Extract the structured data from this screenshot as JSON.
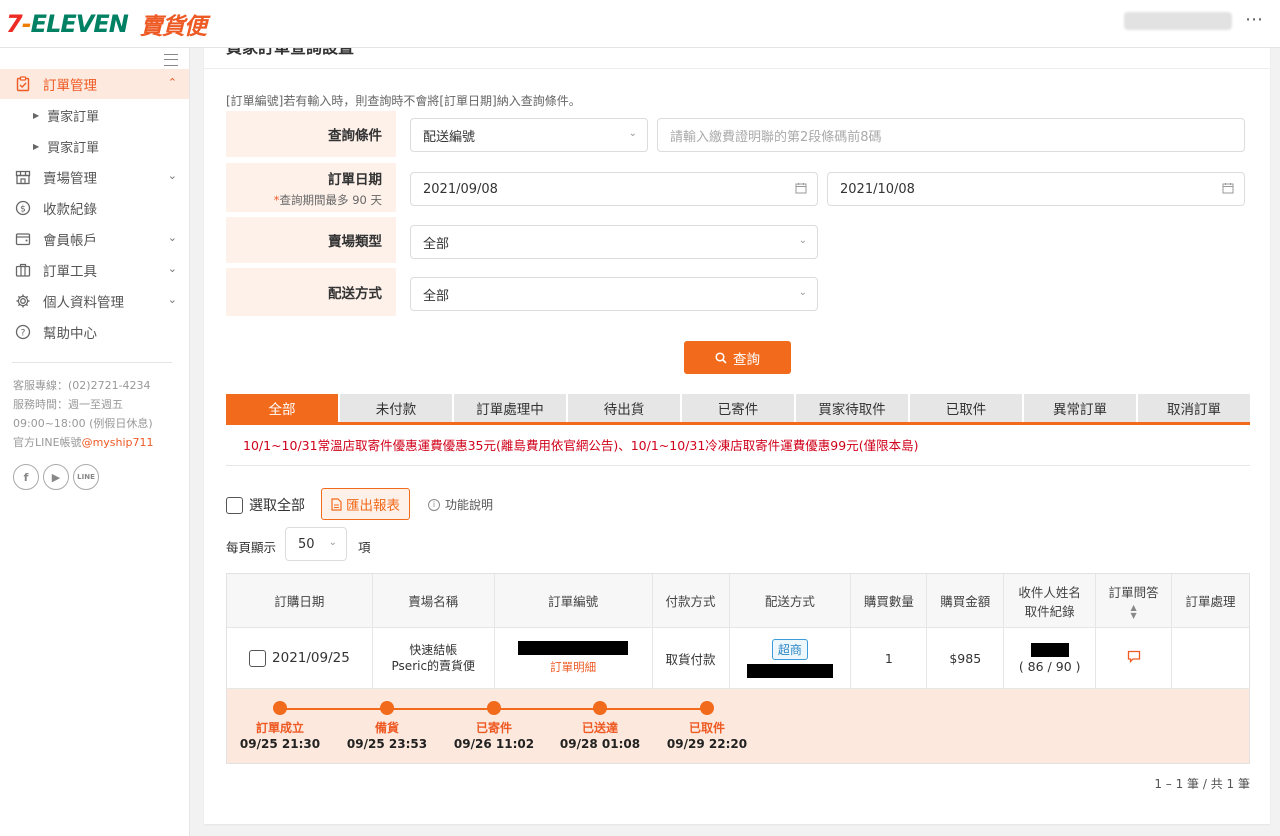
{
  "header": {
    "logo_711": "7-ELEVEN",
    "logo_brand": "賣貨便"
  },
  "sidebar": {
    "items": [
      {
        "label": "訂單管理",
        "icon": "clipboard-check-icon"
      },
      {
        "label": "賣場管理",
        "icon": "store-icon"
      },
      {
        "label": "收款紀錄",
        "icon": "dollar-circle-icon"
      },
      {
        "label": "會員帳戶",
        "icon": "wallet-icon"
      },
      {
        "label": "訂單工具",
        "icon": "briefcase-icon"
      },
      {
        "label": "個人資料管理",
        "icon": "gear-icon"
      },
      {
        "label": "幫助中心",
        "icon": "question-circle-icon"
      }
    ],
    "sub_items": [
      "賣家訂單",
      "買家訂單"
    ],
    "info": {
      "hotline": "客服專線：(02)2721-4234",
      "hours": "服務時間：週一至週五",
      "hours2": "09:00~18:00 (例假日休息)",
      "line_prefix": "官方LINE帳號",
      "line_id": "@myship711"
    },
    "social": [
      "facebook-icon",
      "youtube-icon",
      "line-icon"
    ]
  },
  "main": {
    "title": "買家訂單查詢設置",
    "note": "[訂單編號]若有輸入時，則查詢時不會將[訂單日期]納入查詢條件。",
    "form": {
      "query_label": "查詢條件",
      "query_select": "配送編號",
      "query_placeholder": "請輸入繳費證明聯的第2段條碼前8碼",
      "date_label": "訂單日期",
      "date_sub": "查詢期間最多 90 天",
      "date_star": "*",
      "date_from": "2021/09/08",
      "date_to": "2021/10/08",
      "store_type_label": "賣場類型",
      "store_type_value": "全部",
      "delivery_label": "配送方式",
      "delivery_value": "全部",
      "search_button": "查詢"
    },
    "tabs": [
      "全部",
      "未付款",
      "訂單處理中",
      "待出貨",
      "已寄件",
      "買家待取件",
      "已取件",
      "異常訂單",
      "取消訂單"
    ],
    "promo": "10/1~10/31常溫店取寄件優惠運費優惠35元(離島費用依官網公告)、10/1~10/31冷凍店取寄件運費優惠99元(僅限本島)",
    "select_all": "選取全部",
    "export_button": "匯出報表",
    "func_help": "功能說明",
    "per_page_label": "每頁顯示",
    "per_page_value": "50",
    "per_page_unit": "項",
    "table": {
      "headers": [
        "訂購日期",
        "賣場名稱",
        "訂單編號",
        "付款方式",
        "配送方式",
        "購買數量",
        "購買金額",
        "收件人姓名",
        "取件紀錄",
        "訂單問答",
        "訂單處理"
      ],
      "row": {
        "date": "2021/09/25",
        "store_name_1": "快速結帳",
        "store_name_2": "Pseric的賣貨便",
        "detail_link": "訂單明細",
        "payment": "取貨付款",
        "delivery_badge": "超商",
        "quantity": "1",
        "amount": "$985",
        "pickup_record": "( 86 / 90 )"
      },
      "timeline": [
        {
          "label": "訂單成立",
          "time": "09/25 21:30"
        },
        {
          "label": "備貨",
          "time": "09/25 23:53"
        },
        {
          "label": "已寄件",
          "time": "09/26 11:02"
        },
        {
          "label": "已送達",
          "time": "09/28 01:08"
        },
        {
          "label": "已取件",
          "time": "09/29 22:20"
        }
      ]
    },
    "pager": "1 – 1 筆 / 共 1 筆"
  },
  "colors": {
    "accent": "#f26a1b",
    "accent_light": "#fdf1ea",
    "promo_red": "#d0021b"
  }
}
